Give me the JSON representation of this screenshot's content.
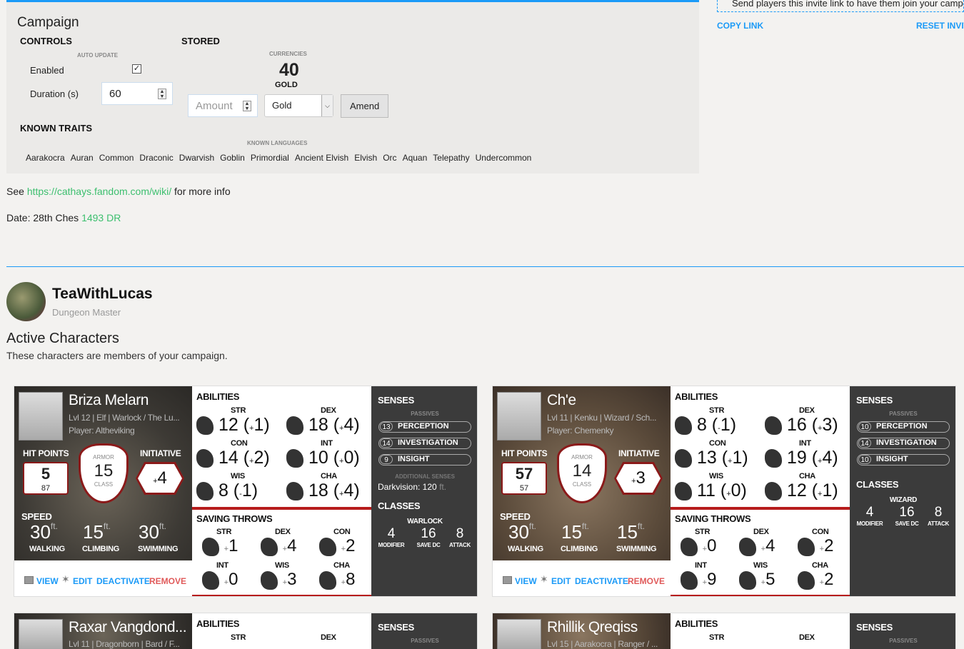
{
  "campaign": {
    "title": "Campaign",
    "controls": "CONTROLS",
    "auto_update": "AUTO UPDATE",
    "enabled_label": "Enabled",
    "enabled": true,
    "duration_label": "Duration (s)",
    "duration_value": "60",
    "stored": "STORED",
    "currencies": "CURRENCIES",
    "amount": "40",
    "currency": "GOLD",
    "amount_placeholder": "Amount",
    "currency_select": "Gold",
    "amend": "Amend",
    "known_traits": "KNOWN TRAITS",
    "known_languages": "KNOWN LANGUAGES",
    "languages": [
      "Aarakocra",
      "Auran",
      "Common",
      "Draconic",
      "Dwarvish",
      "Goblin",
      "Primordial",
      "Ancient Elvish",
      "Elvish",
      "Orc",
      "Aquan",
      "Telepathy",
      "Undercommon"
    ]
  },
  "invite": {
    "text": "Send players this invite link to have them join your campaign",
    "copy": "COPY LINK",
    "reset": "RESET INVITE"
  },
  "info": {
    "see": "See",
    "url": "https://cathays.fandom.com/wiki/",
    "more": "for more info",
    "date_label": "Date: 28th Ches",
    "year": "1493 DR"
  },
  "dm": {
    "name": "TeaWithLucas",
    "role": "Dungeon Master"
  },
  "active": {
    "title": "Active Characters",
    "desc": "These characters are members of your campaign."
  },
  "labels": {
    "hp": "HIT POINTS",
    "armor": "ARMOR",
    "class": "CLASS",
    "init": "INITIATIVE",
    "speed": "SPEED",
    "ft": "ft.",
    "walking": "WALKING",
    "climbing": "CLIMBING",
    "swimming": "SWIMMING",
    "view": "VIEW",
    "edit": "EDIT",
    "deactivate": "DEACTIVATE",
    "remove": "REMOVE",
    "abilities": "ABILITIES",
    "saves": "SAVING THROWS",
    "senses": "SENSES",
    "passives": "PASSIVES",
    "perception": "PERCEPTION",
    "investigation": "INVESTIGATION",
    "insight": "INSIGHT",
    "additional": "ADDITIONAL SENSES",
    "classes": "CLASSES",
    "modifier": "MODIFIER",
    "savedc": "SAVE DC",
    "attack": "ATTACK",
    "str": "STR",
    "dex": "DEX",
    "con": "CON",
    "int": "INT",
    "wis": "WIS",
    "cha": "CHA"
  },
  "characters": [
    {
      "name": "Briza Melarn",
      "sub": "Lvl 12 | Elf | Warlock / The Lu...",
      "player": "Player: Altheviking",
      "hp": "5",
      "hp_max": "87",
      "ac": "15",
      "init_sign": "+",
      "init": "4",
      "speed": [
        "30",
        "15",
        "30"
      ],
      "abilities": [
        [
          "12",
          "+",
          "1"
        ],
        [
          "18",
          "+",
          "4"
        ],
        [
          "14",
          "+",
          "2"
        ],
        [
          "10",
          "+",
          "0"
        ],
        [
          "8",
          "-",
          "1"
        ],
        [
          "18",
          "+",
          "4"
        ]
      ],
      "saves": [
        [
          "+",
          "1"
        ],
        [
          "+",
          "4"
        ],
        [
          "+",
          "2"
        ],
        [
          "+",
          "0"
        ],
        [
          "+",
          "3"
        ],
        [
          "+",
          "8"
        ]
      ],
      "passives": [
        "13",
        "14",
        "9"
      ],
      "additional": "Darkvision: 120",
      "class_name": "WARLOCK",
      "class_stats": [
        "4",
        "16",
        "8"
      ]
    },
    {
      "name": "Ch'e",
      "sub": "Lvl 11 | Kenku | Wizard / Sch...",
      "player": "Player: Chemenky",
      "hp": "57",
      "hp_max": "57",
      "ac": "14",
      "init_sign": "+",
      "init": "3",
      "speed": [
        "30",
        "15",
        "15"
      ],
      "abilities": [
        [
          "8",
          "-",
          "1"
        ],
        [
          "16",
          "+",
          "3"
        ],
        [
          "13",
          "+",
          "1"
        ],
        [
          "19",
          "+",
          "4"
        ],
        [
          "11",
          "+",
          "0"
        ],
        [
          "12",
          "+",
          "1"
        ]
      ],
      "saves": [
        [
          "+",
          "0"
        ],
        [
          "+",
          "4"
        ],
        [
          "+",
          "2"
        ],
        [
          "+",
          "9"
        ],
        [
          "+",
          "5"
        ],
        [
          "+",
          "2"
        ]
      ],
      "passives": [
        "10",
        "14",
        "10"
      ],
      "class_name": "WIZARD",
      "class_stats": [
        "4",
        "16",
        "8"
      ]
    }
  ],
  "partial": [
    {
      "name": "Raxar Vangdond...",
      "sub": "Lvl 11 | Dragonborn | Bard / F..."
    },
    {
      "name": "Rhillik Qreqiss",
      "sub": "Lvl 15 | Aarakocra | Ranger / ..."
    }
  ],
  "colors": {
    "accent": "#1b9af7",
    "link": "#3cbf6e",
    "danger": "#d9534f",
    "card_red": "#b71c1c"
  },
  "icons": {
    "str": "bull-icon",
    "dex": "cat-icon",
    "con": "bear-icon",
    "int": "fox-icon",
    "wis": "owl-icon",
    "cha": "eagle-icon"
  }
}
